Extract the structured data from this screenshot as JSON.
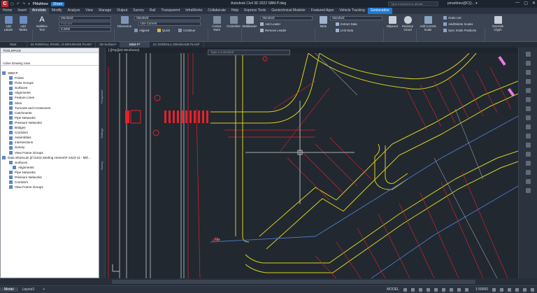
{
  "title_bar": {
    "app_icon": "C",
    "qat_items": [
      "▢",
      "↶",
      "↷",
      "▾",
      "Share"
    ],
    "workspace": "PMatthew",
    "window_title": "Autodesk Civil 3D 2022   SBM-P.dwg",
    "search_placeholder": "Type a keyword or phrase",
    "user": "pmartinez@CQ... ▾",
    "controls": [
      "—",
      "▢",
      "✕"
    ]
  },
  "ribbon_tabs": [
    "Home",
    "Insert",
    "Annotate",
    "Modify",
    "Analyze",
    "View",
    "Manage",
    "Output",
    "Survey",
    "Rail",
    "Transparent",
    "InfraWorks",
    "Collaborate",
    "Help",
    "Express Tools",
    "Geotechnical Modeler",
    "Featured Apps",
    "Vehicle Tracking",
    "Geolocation"
  ],
  "ribbon": {
    "add_labels": "Add Labels",
    "add_tables": "Add Tables",
    "multiline_text": "Multiline Text",
    "text_style": "Standard",
    "find_text": "Find text",
    "text_height": "0.2000",
    "dimension": "Dimension",
    "dim_style": "Standard",
    "use_current": "Use Current",
    "aligned": "Aligned",
    "quick": "Quick",
    "continue_label": "Continue",
    "center_mark": "Center Mark",
    "centerline": "Centerline",
    "multileader": "Multileader",
    "mleader_style": "Standard",
    "add_leader": "Add Leader",
    "remove_leader": "Remove Leader",
    "table": "Table",
    "table_style": "Standard",
    "extract_data": "Extract Data",
    "link_data": "Link Data",
    "wipeout": "Wipeout",
    "revision_cloud": "Revision Cloud",
    "add_current_scale": "Add Current Scale",
    "scale_list": "Scale List",
    "add_delete_scales": "Add/Delete Scales",
    "sync_scale_positions": "Sync Scale Positions",
    "override_glyph": "Override Glyph",
    "panels": [
      "Labels & Tables ▾",
      "Text ▾",
      "Dimensions ▾",
      "Centerlines",
      "Leaders",
      "Tables",
      "Markup",
      "Annotation Scaling",
      "Label Text"
    ]
  },
  "doc_tabs": [
    "Start",
    "24 OVERALL PAVIN...G DRAINAGE PLAN*",
    "3D Surface*",
    "SBM-P*",
    "1C OVERALL DRAINAGE PLAN*"
  ],
  "toolspace": {
    "header": "TOOLSPACE",
    "view": "Active Drawing View",
    "tree": [
      {
        "label": "SBM-P",
        "level": 0
      },
      {
        "label": "Points",
        "level": 2
      },
      {
        "label": "Point Groups",
        "level": 2
      },
      {
        "label": "Surfaces",
        "level": 2
      },
      {
        "label": "Alignments",
        "level": 2
      },
      {
        "label": "Feature Lines",
        "level": 2
      },
      {
        "label": "Sites",
        "level": 2
      },
      {
        "label": "Turnouts and Crossovers",
        "level": 2
      },
      {
        "label": "Catchments",
        "level": 2
      },
      {
        "label": "Pipe Networks",
        "level": 2
      },
      {
        "label": "Pressure Networks",
        "level": 2
      },
      {
        "label": "Bridges",
        "level": 2
      },
      {
        "label": "Corridors",
        "level": 2
      },
      {
        "label": "Assemblies",
        "level": 2
      },
      {
        "label": "Intersections",
        "level": 2
      },
      {
        "label": "Survey",
        "level": 2
      },
      {
        "label": "View Frame Groups",
        "level": 2
      },
      {
        "label": "Data Shortcuts [Z:\\2423 Sterling Homes\\P-2423-11 - Mill...",
        "level": 0
      },
      {
        "label": "Surfaces",
        "level": 2
      },
      {
        "label": "Alignments",
        "level": 3
      },
      {
        "label": "Pipe Networks",
        "level": 2
      },
      {
        "label": "Pressure Networks",
        "level": 2
      },
      {
        "label": "Corridors",
        "level": 2
      },
      {
        "label": "View Frame Groups",
        "level": 2
      }
    ]
  },
  "side_labels": [
    "Prospector",
    "Settings",
    "Survey"
  ],
  "viewport": {
    "label": "[-][Top][2D Wireframe]",
    "command_placeholder": "Type a command",
    "coord_label": "←N/A"
  },
  "status": {
    "layouts": [
      "Model",
      "Layout1",
      "+"
    ],
    "mode": "MODEL",
    "scale": "1:50000"
  },
  "colors": {
    "red": "#e8212b",
    "yellow": "#d9d21c",
    "white": "#c8ccd2",
    "blue": "#4b7ac8"
  }
}
